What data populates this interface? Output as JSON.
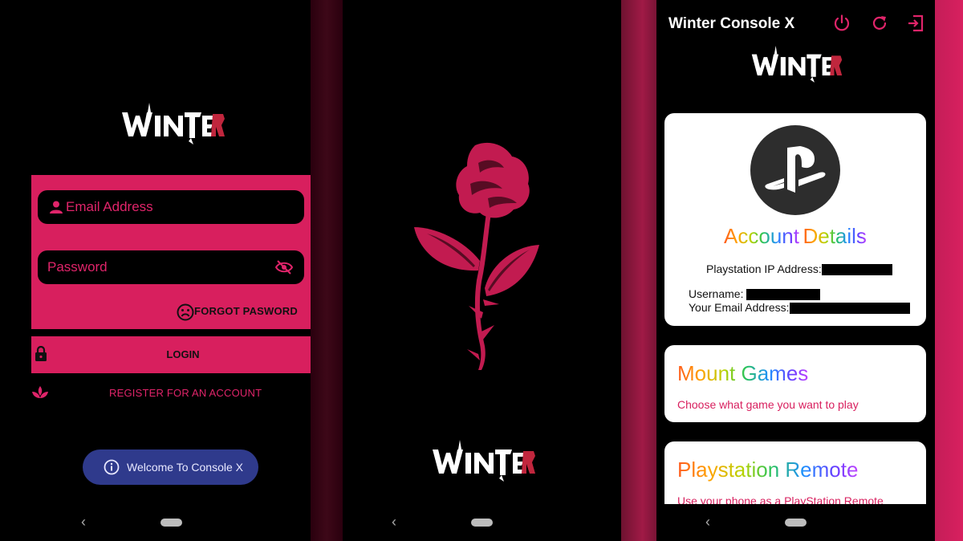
{
  "colors": {
    "accent": "#d81f5e",
    "toast": "#2f3a8c",
    "card": "#ffffff"
  },
  "brand": {
    "logo_text": "WINTER"
  },
  "login_screen": {
    "email_placeholder": "Email Address",
    "password_placeholder": "Password",
    "forgot_label": "FORGOT PASWORD",
    "login_label": "LOGIN",
    "register_label": "REGISTER FOR AN ACCOUNT",
    "toast_text": "Welcome To Console X",
    "icons": [
      "person-icon",
      "eye-off-icon",
      "sad-face-icon",
      "lock-icon",
      "lotus-icon",
      "info-icon"
    ]
  },
  "splash_screen": {
    "icons": [
      "rose-icon"
    ]
  },
  "dashboard": {
    "title": "Winter Console X",
    "toolbar_icons": [
      "power-icon",
      "refresh-icon",
      "logout-icon"
    ],
    "account_card": {
      "title_part1": "Account",
      "title_part2": "Details",
      "ip_label": "Playstation IP Address:",
      "username_label": "Username:",
      "email_label": "Your Email Address:",
      "icon": "playstation-icon"
    },
    "mount_card": {
      "title": "Mount Games",
      "subtitle": "Choose what game you want to play"
    },
    "remote_card": {
      "title": "Playstation Remote",
      "subtitle": "Use your phone as a PlayStation Remote"
    }
  },
  "navigation": {
    "back_glyph": "‹"
  }
}
